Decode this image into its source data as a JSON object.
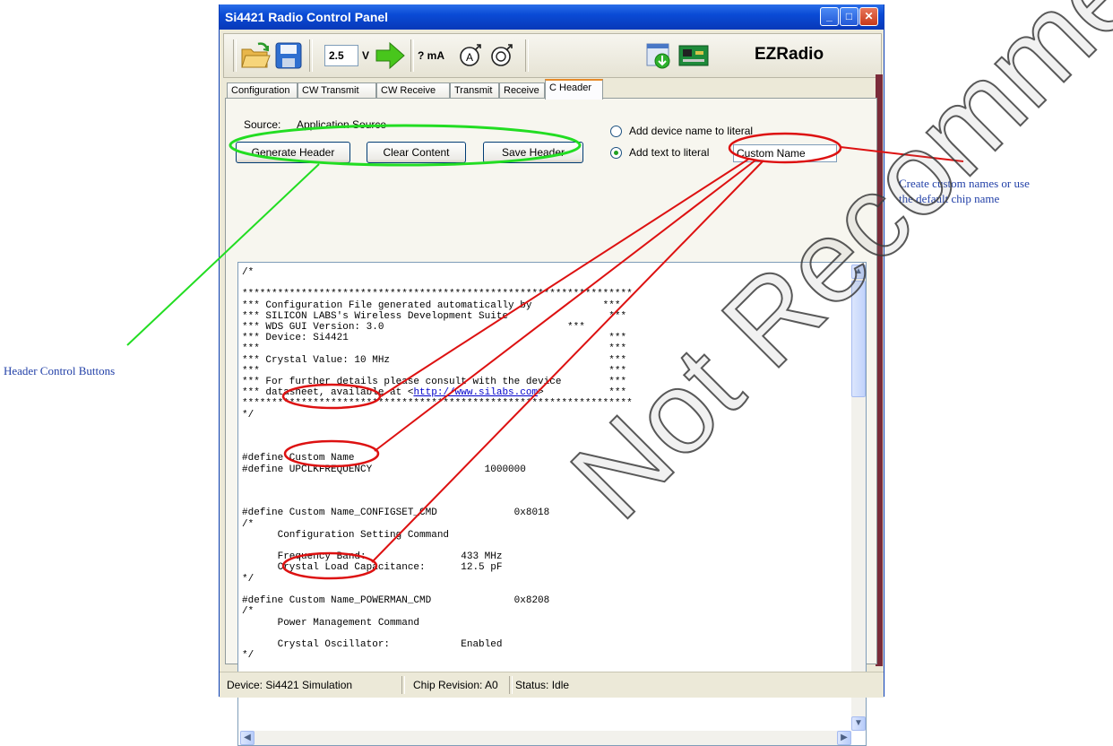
{
  "window": {
    "title": "Si4421 Radio Control Panel",
    "minimize_label": "_",
    "maximize_label": "□",
    "close_label": "✕"
  },
  "toolbar": {
    "voltage": "2.5",
    "voltage_unit": "V",
    "current": "? mA",
    "brand": "EZRadio",
    "icons": [
      "open-folder-icon",
      "save-disk-icon",
      "voltage-apply-arrow-icon",
      "measure-current-icon",
      "reset-chip-icon",
      "download-icon",
      "board-icon"
    ]
  },
  "tabs": [
    "Configuration",
    "CW Transmit",
    "CW Receive",
    "Transmit",
    "Receive",
    "C Header"
  ],
  "active_tab": "C Header",
  "header_panel": {
    "source_label": "Source:",
    "source_value": "Application Source",
    "radio_device_label": "Add device name to literal",
    "radio_text_label": "Add text to literal",
    "custom_name_value": "Custom Name",
    "buttons": {
      "generate": "Generate Header",
      "clear": "Clear Content",
      "save": "Save Header"
    }
  },
  "code": {
    "lines": [
      "/*",
      "",
      "******************************************************************",
      "*** Configuration File generated automatically by            ***",
      "*** SILICON LABS's Wireless Development Suite                 ***",
      "*** WDS GUI Version: 3.0                               ***",
      "*** Device: Si4421                                            ***",
      "***                                                           ***",
      "*** Crystal Value: 10 MHz                                     ***",
      "***                                                           ***",
      "*** For further details please consult with the device        ***",
      "*** datasheet, available at <http://www.silabs.com>           ***",
      "******************************************************************",
      "*/",
      "",
      "",
      "",
      "#define Custom Name",
      "#define UPCLKFREQUENCY                   1000000",
      "",
      "",
      "",
      "#define Custom Name_CONFIGSET_CMD             0x8018",
      "/*",
      "      Configuration Setting Command",
      "",
      "      Frequency Band:                433 MHz",
      "      Crystal Load Capacitance:      12.5 pF",
      "*/",
      "",
      "#define Custom Name_POWERMAN_CMD              0x8208",
      "/*",
      "      Power Management Command",
      "",
      "      Crystal Oscillator:            Enabled",
      "*/"
    ],
    "link_text": "http://www.silabs.com"
  },
  "status": {
    "device": "Device: Si4421 Simulation",
    "chip": "Chip Revision: A0",
    "state": "Status: Idle"
  },
  "annotations": {
    "left": "Header Control Buttons",
    "right_line1": "Create custom names or use",
    "right_line2": "the default chip name"
  },
  "watermark": "Not Recommended for New Designs",
  "colors": {
    "titlebar": "#0a4bd6",
    "annotation_text": "#2341a8",
    "callout_green": "#22dd22",
    "callout_red": "#dd1111"
  }
}
